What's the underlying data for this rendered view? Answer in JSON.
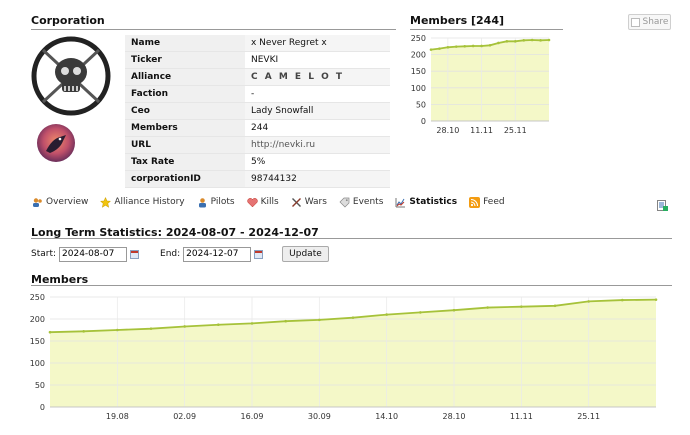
{
  "corporation": {
    "title": "Corporation",
    "rows": [
      {
        "label": "Name",
        "value": "x Never Regret x"
      },
      {
        "label": "Ticker",
        "value": "NEVKI"
      },
      {
        "label": "Alliance",
        "value": "C A M E L O T"
      },
      {
        "label": "Faction",
        "value": "-"
      },
      {
        "label": "Ceo",
        "value": "Lady Snowfall"
      },
      {
        "label": "Members",
        "value": "244"
      },
      {
        "label": "URL",
        "value": "http://nevki.ru"
      },
      {
        "label": "Tax Rate",
        "value": "5%"
      },
      {
        "label": "corporationID",
        "value": "98744132"
      }
    ]
  },
  "members_panel": {
    "title": "Members [244]"
  },
  "share_label": "Share",
  "tabs": [
    {
      "label": "Overview",
      "icon": "users-icon"
    },
    {
      "label": "Alliance History",
      "icon": "star-icon"
    },
    {
      "label": "Pilots",
      "icon": "pilot-icon"
    },
    {
      "label": "Kills",
      "icon": "heart-icon"
    },
    {
      "label": "Wars",
      "icon": "swords-icon"
    },
    {
      "label": "Events",
      "icon": "tag-icon"
    },
    {
      "label": "Statistics",
      "icon": "chart-icon"
    },
    {
      "label": "Feed",
      "icon": "rss-icon"
    }
  ],
  "long_term": {
    "title": "Long Term Statistics: 2024-08-07 - 2024-12-07",
    "start_label": "Start:",
    "start_value": "2024-08-07",
    "end_label": "End:",
    "end_value": "2024-12-07",
    "update_label": "Update",
    "members_title": "Members"
  },
  "colors": {
    "fill": "#f4f8c8",
    "line": "#a6c23a",
    "grid": "#e2e2e2"
  },
  "chart_data": [
    {
      "type": "area",
      "ylim": [
        0,
        250
      ],
      "yticks": [
        0,
        50,
        100,
        150,
        200,
        250
      ],
      "xticks": [
        "28.10",
        "11.11",
        "25.11"
      ],
      "grid": true,
      "x": [
        "21.10",
        "24.10",
        "28.10",
        "01.11",
        "04.11",
        "08.11",
        "11.11",
        "14.11",
        "18.11",
        "21.11",
        "25.11",
        "28.11",
        "02.12",
        "05.12",
        "07.12"
      ],
      "values": [
        215,
        218,
        222,
        224,
        225,
        226,
        226,
        228,
        235,
        240,
        240,
        243,
        244,
        243,
        244
      ]
    },
    {
      "type": "area",
      "ylim": [
        0,
        250
      ],
      "yticks": [
        0,
        50,
        100,
        150,
        200,
        250
      ],
      "xticks": [
        "19.08",
        "02.09",
        "16.09",
        "30.09",
        "14.10",
        "28.10",
        "11.11",
        "25.11"
      ],
      "grid": true,
      "x": [
        "07.08",
        "12.08",
        "19.08",
        "26.08",
        "02.09",
        "09.09",
        "16.09",
        "23.09",
        "30.09",
        "07.10",
        "14.10",
        "21.10",
        "28.10",
        "04.11",
        "11.11",
        "18.11",
        "25.11",
        "02.12",
        "07.12"
      ],
      "values": [
        170,
        172,
        175,
        178,
        183,
        187,
        190,
        195,
        198,
        203,
        210,
        215,
        220,
        226,
        228,
        230,
        240,
        243,
        244
      ]
    }
  ]
}
